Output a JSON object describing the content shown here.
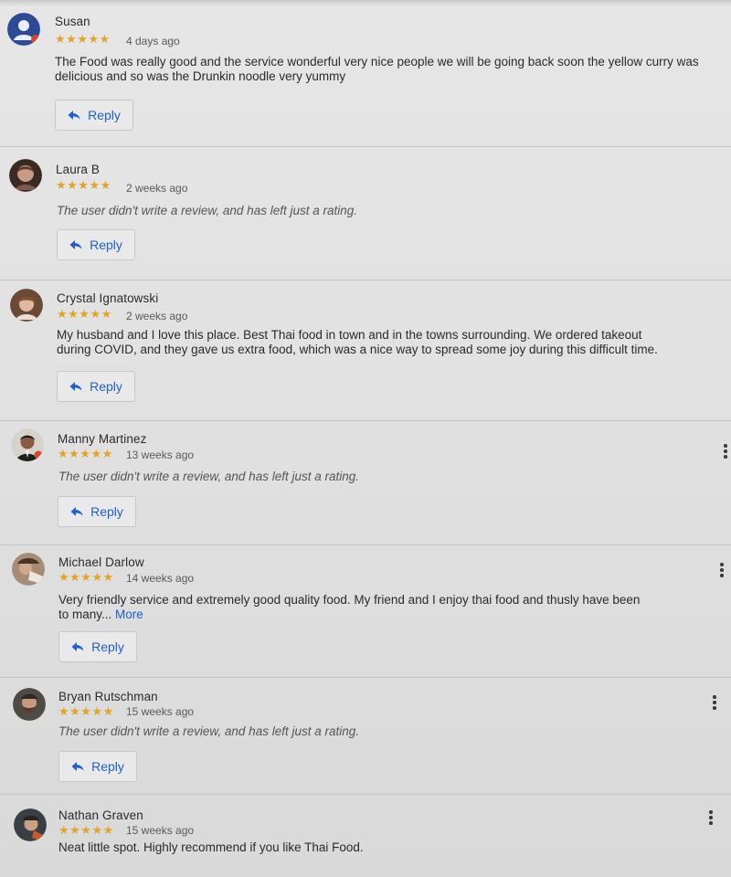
{
  "reviews": [
    {
      "name": "Susan",
      "stars": "★★★★★",
      "time": "4 days ago",
      "text": "The Food was really good and the service wonderful very nice people we will be going back soon the yellow curry was delicious and so was the Drunkin noodle very yummy",
      "reply": "Reply"
    },
    {
      "name": "Laura B",
      "stars": "★★★★★",
      "time": "2 weeks ago",
      "text": "The user didn't write a review, and has left just a rating.",
      "reply": "Reply"
    },
    {
      "name": "Crystal Ignatowski",
      "stars": "★★★★★",
      "time": "2 weeks ago",
      "text": "My husband and I love this place. Best Thai food in town and in the towns surrounding. We ordered takeout during COVID, and they gave us extra food, which was a nice way to spread some joy during this difficult time.",
      "reply": "Reply"
    },
    {
      "name": "Manny Martinez",
      "stars": "★★★★★",
      "time": "13 weeks ago",
      "text": "The user didn't write a review, and has left just a rating.",
      "reply": "Reply"
    },
    {
      "name": "Michael Darlow",
      "stars": "★★★★★",
      "time": "14 weeks ago",
      "text": "Very friendly service and extremely good quality food. My friend and I enjoy thai food and thusly have been to many...",
      "more": "More",
      "reply": "Reply"
    },
    {
      "name": "Bryan Rutschman",
      "stars": "★★★★★",
      "time": "15 weeks ago",
      "text": "The user didn't write a review, and has left just a rating.",
      "reply": "Reply"
    },
    {
      "name": "Nathan Graven",
      "stars": "★★★★★",
      "time": "15 weeks ago",
      "text": "Neat little spot. Highly recommend if you like Thai Food."
    }
  ],
  "colors": {
    "star": "#e3a423",
    "link": "#1a5fd1",
    "reply_text": "#1f5fd0"
  },
  "icons": {
    "reply": "reply-arrow-icon",
    "menu": "more-vert-icon",
    "star": "star-icon"
  }
}
